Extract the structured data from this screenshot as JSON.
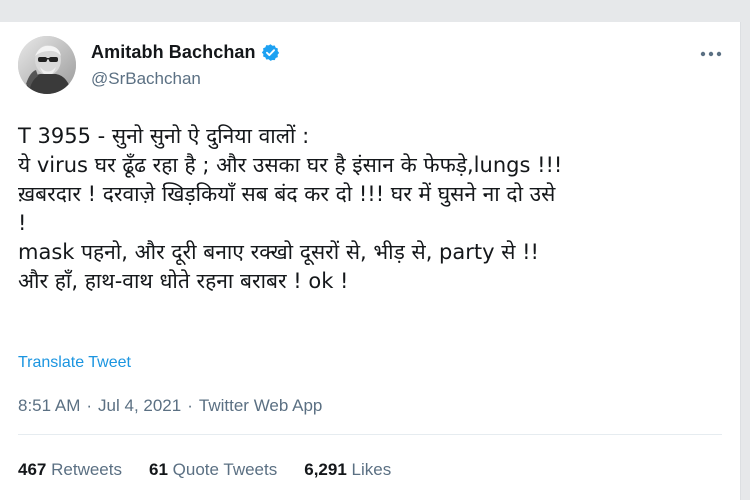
{
  "tweet": {
    "author": {
      "display_name": "Amitabh Bachchan",
      "handle": "@SrBachchan",
      "verified": true,
      "avatar_icon": "profile-photo"
    },
    "lines": [
      "T 3955 - सुनो सुनो ऐ दुनिया वालों  :",
      "ये virus घर ढूँढ रहा है ; और उसका घर है इंसान के फेफड़े,lungs  !!!",
      "ख़बरदार  ! दरवाज़े खिड़कियाँ सब बंद कर दो  !!! घर में घुसने ना दो उसे",
      "!",
      "mask पहनो, और दूरी बनाए रक्खो दूसरों से, भीड़ से, party से  !!",
      "और हाँ, हाथ-वाथ धोते रहना बराबर  ! ok !"
    ],
    "translate_label": "Translate Tweet",
    "meta": {
      "time": "8:51 AM",
      "date": "Jul 4, 2021",
      "source": "Twitter Web App",
      "separator": "·"
    },
    "stats": {
      "retweets_count": "467",
      "retweets_label": "Retweets",
      "quotes_count": "61",
      "quotes_label": "Quote Tweets",
      "likes_count": "6,291",
      "likes_label": "Likes"
    }
  },
  "colors": {
    "text_primary": "#14171a",
    "text_secondary": "#5b7083",
    "link": "#1b95e0",
    "verified": "#1da1f2"
  }
}
